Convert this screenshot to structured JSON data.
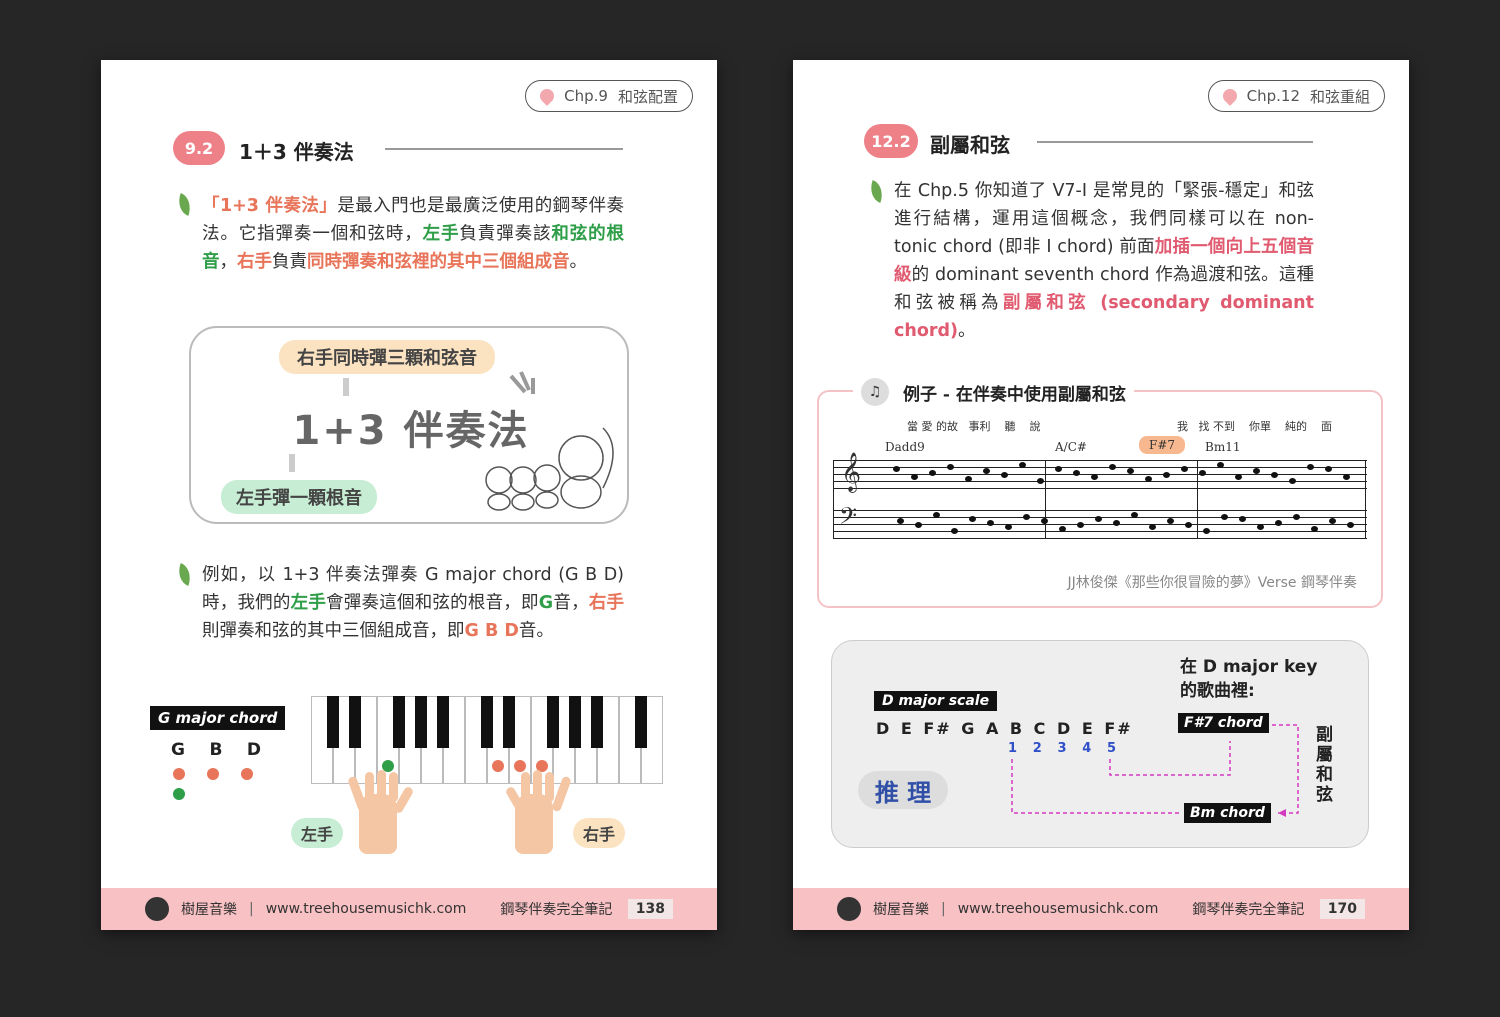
{
  "left": {
    "chapter": {
      "num": "Chp.9",
      "name": "和弦配置"
    },
    "section": {
      "num": "9.2",
      "title": "1＋3 伴奏法"
    },
    "para1": {
      "q_open": "「",
      "term": "1+3 伴奏法",
      "q_close": "」",
      "t1": "是最入門也是最廣泛使用的鋼琴伴奏法。它指彈奏一個和弦時，",
      "left_hand": "左手",
      "t2": "負責彈奏該",
      "root": "和弦的根音",
      "comma": "，",
      "right_hand": "右手",
      "t3": "負責",
      "three": "同時彈奏和弦裡的其中三個組成音",
      "end": "。"
    },
    "diagram": {
      "top_pill": "右手同時彈三顆和弦音",
      "main": "1+3 伴奏法",
      "bottom_pill": "左手彈一顆根音"
    },
    "para2": {
      "t1": "例如，以 1+3 伴奏法彈奏 G major chord (G B D) 時，我們的",
      "left_hand": "左手",
      "t2": "會彈奏這個和弦的根音，即",
      "g": "G",
      "t3": "音，",
      "right_hand": "右手",
      "t4": "則彈奏和弦的其中三個組成音，即",
      "gbd": "G B D",
      "t5": "音。"
    },
    "chord_label": "G major chord",
    "chord_notes": [
      "G",
      "B",
      "D"
    ],
    "hand_left": "左手",
    "hand_right": "右手",
    "footer": {
      "brand": "樹屋音樂",
      "sep": "|",
      "url": "www.treehousemusichk.com",
      "book": "鋼琴伴奏完全筆記",
      "page": "138"
    }
  },
  "right": {
    "chapter": {
      "num": "Chp.12",
      "name": "和弦重組"
    },
    "section": {
      "num": "12.2",
      "title": "副屬和弦"
    },
    "para": {
      "t1": "在 Chp.5 你知道了 V7-I 是常見的「緊張-穩定」和弦進行結構，運用這個概念，我們同樣可以在 non-tonic chord (即非 I chord) 前面",
      "insert": "加插一個向上五個音級",
      "t2": "的 dominant seventh chord 作為過渡和弦。這種和弦被稱為",
      "term": "副屬和弦 (secondary dominant chord)",
      "end": "。"
    },
    "example": {
      "title": "例子 - 在伴奏中使用副屬和弦",
      "lyrics_a": "當 愛 的故   事利    聽    說",
      "lyrics_b": "我   找 不到    你單    純的    面",
      "chords": [
        "Dadd9",
        "A/C#",
        "F#7",
        "Bm11"
      ],
      "caption": "JJ林俊傑《那些你很冒險的夢》Verse 鋼琴伴奏"
    },
    "reason": {
      "key_title": "在 D major key",
      "key_title2": "的歌曲裡:",
      "scale_label": "D major scale",
      "scale": "D E F# G A B C D E F#",
      "degrees": [
        "1",
        "2",
        "3",
        "4",
        "5"
      ],
      "fs7": "F#7 chord",
      "bm": "Bm chord",
      "badge": "推 理",
      "vertical": "副屬和弦"
    },
    "footer": {
      "brand": "樹屋音樂",
      "sep": "|",
      "url": "www.treehousemusichk.com",
      "book": "鋼琴伴奏完全筆記",
      "page": "170"
    }
  },
  "colors": {
    "pink": "#ee8088",
    "orange": "#e8745a",
    "green": "#2e9e48",
    "footer": "#f8c1c4"
  }
}
